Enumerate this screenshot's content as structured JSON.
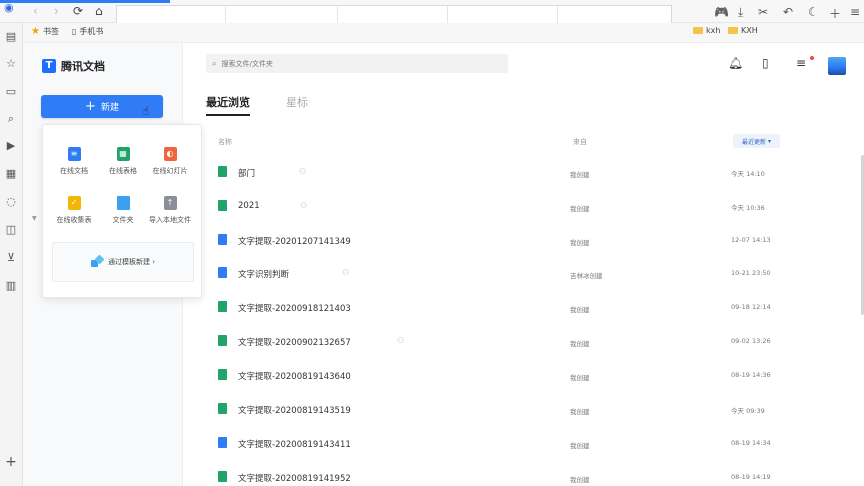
{
  "browser": {
    "nav": {
      "back": "‹",
      "forward": "›",
      "reload": "⟳",
      "home": "⌂"
    },
    "toolbar_icons": [
      "game-icon",
      "download-icon",
      "scissors-icon",
      "undo-icon",
      "moon-icon",
      "plus-icon",
      "menu-icon"
    ],
    "bookmarks": {
      "bookmark_label": "书签",
      "mobile_label": "手机书",
      "folder1": "kxh",
      "folder2": "KXH"
    }
  },
  "app": {
    "logo_text": "腾讯文档",
    "new_button": "新建",
    "search_placeholder": "搜索文件/文件夹",
    "tabs": [
      "最近浏览",
      "星标"
    ],
    "columns": {
      "name": "名称",
      "owner": "来自",
      "sort": "最近更新"
    },
    "new_menu": {
      "options": [
        {
          "label": "在线文档",
          "icon": "online-doc-icon",
          "color": "#2f7cf6"
        },
        {
          "label": "在线表格",
          "icon": "online-sheet-icon",
          "color": "#21a36a"
        },
        {
          "label": "在线幻灯片",
          "icon": "online-slides-icon",
          "color": "#f0663c"
        },
        {
          "label": "在线收集表",
          "icon": "collect-form-icon",
          "color": "#f2b705"
        },
        {
          "label": "文件夹",
          "icon": "folder-icon",
          "color": "#3aa1f2"
        },
        {
          "label": "导入本地文件",
          "icon": "import-icon",
          "color": "#8a8f98"
        }
      ],
      "template_link": "通过模板新建 ›"
    }
  },
  "files": [
    {
      "name": "部门",
      "type": "sheet",
      "shared": true,
      "owner": "我创建",
      "time": "今天 14:10"
    },
    {
      "name": "2021",
      "type": "sheet",
      "shared": true,
      "owner": "我创建",
      "time": "今天 10:36"
    },
    {
      "name": "文字提取-20201207141349",
      "type": "doc",
      "shared": false,
      "owner": "我创建",
      "time": "12-07 14:13"
    },
    {
      "name": "文字识别判断",
      "type": "doc",
      "shared": true,
      "owner": "吉林冰创建",
      "time": "10-21 23:50"
    },
    {
      "name": "文字提取-20200918121403",
      "type": "sheet",
      "shared": false,
      "owner": "我创建",
      "time": "09-18 12:14"
    },
    {
      "name": "文字提取-20200902132657",
      "type": "sheet",
      "shared": true,
      "owner": "我创建",
      "time": "09-02 13:26"
    },
    {
      "name": "文字提取-20200819143640",
      "type": "sheet",
      "shared": false,
      "owner": "我创建",
      "time": "08-19 14:36"
    },
    {
      "name": "文字提取-20200819143519",
      "type": "sheet",
      "shared": false,
      "owner": "我创建",
      "time": "今天 09:39"
    },
    {
      "name": "文字提取-20200819143411",
      "type": "doc",
      "shared": false,
      "owner": "我创建",
      "time": "08-19 14:34"
    },
    {
      "name": "文字提取-20200819141952",
      "type": "sheet",
      "shared": false,
      "owner": "我创建",
      "time": "08-19 14:19"
    }
  ]
}
